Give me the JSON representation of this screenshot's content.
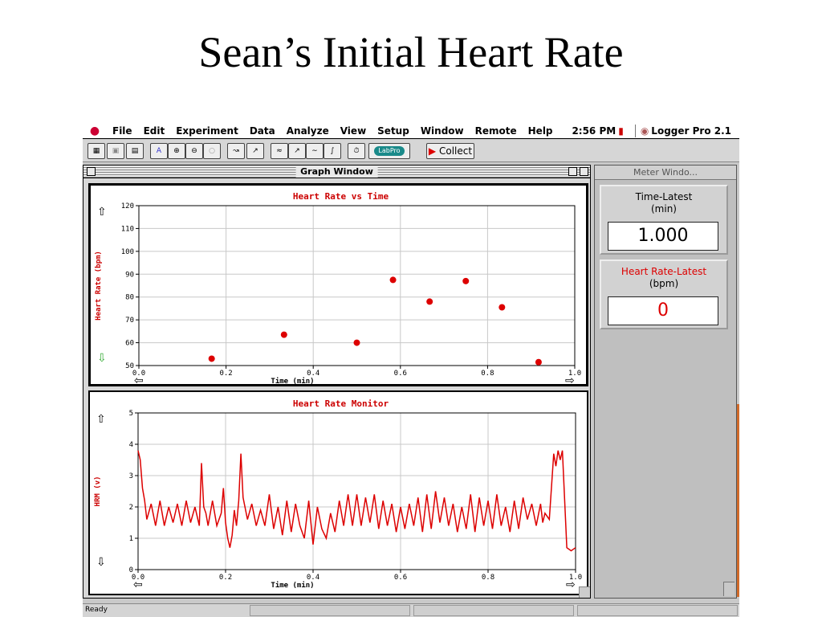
{
  "slide": {
    "title": "Sean’s Initial Heart Rate"
  },
  "menubar": {
    "items": [
      "File",
      "Edit",
      "Experiment",
      "Data",
      "Analyze",
      "View",
      "Setup",
      "Window",
      "Remote",
      "Help"
    ],
    "clock": "2:56 PM",
    "app_name": "Logger Pro 2.1"
  },
  "toolbar": {
    "buttons": [
      {
        "name": "open-button",
        "icon": "folder-icon"
      },
      {
        "name": "save-button",
        "icon": "disk-icon"
      },
      {
        "name": "print-button",
        "icon": "printer-icon"
      },
      {
        "name": "autoscale-button",
        "icon": "autoscale-icon"
      },
      {
        "name": "zoom-in-button",
        "icon": "zoom-in-icon"
      },
      {
        "name": "zoom-out-button",
        "icon": "zoom-out-icon"
      },
      {
        "name": "zoom-button",
        "icon": "zoom-icon"
      },
      {
        "name": "examine-button",
        "icon": "examine-icon"
      },
      {
        "name": "tangent-button",
        "icon": "tangent-icon"
      },
      {
        "name": "stats-button",
        "icon": "stats-icon"
      },
      {
        "name": "linear-fit-button",
        "icon": "linear-fit-icon"
      },
      {
        "name": "curve-fit-button",
        "icon": "curve-fit-icon"
      },
      {
        "name": "integral-button",
        "icon": "integral-icon"
      },
      {
        "name": "timer-button",
        "icon": "stopwatch-icon"
      }
    ],
    "labpro_label": "LabPro",
    "collect_label": "Collect"
  },
  "graph_window": {
    "title": "Graph Window"
  },
  "meter_window": {
    "title": "Meter Windo...",
    "meters": [
      {
        "label": "Time-Latest",
        "unit": "(min)",
        "value": "1.000",
        "color": "#000000"
      },
      {
        "label": "Heart Rate-Latest",
        "unit": "(bpm)",
        "value": "0",
        "color": "#dd0000"
      }
    ]
  },
  "status": {
    "text": "Ready"
  },
  "chart_data": [
    {
      "type": "scatter",
      "title": "Heart Rate vs Time",
      "xlabel": "Time (min)",
      "ylabel": "Heart Rate (bpm)",
      "xlim": [
        0.0,
        1.0
      ],
      "ylim": [
        50,
        120
      ],
      "xticks": [
        "0.0",
        "0.2",
        "0.4",
        "0.6",
        "0.8",
        "1.0"
      ],
      "yticks": [
        "50",
        "60",
        "70",
        "80",
        "90",
        "100",
        "110",
        "120"
      ],
      "grid": true,
      "color": "#dd0000",
      "x": [
        0.167,
        0.333,
        0.5,
        0.583,
        0.667,
        0.75,
        0.833,
        0.917
      ],
      "y": [
        53,
        63.5,
        60,
        87.5,
        78,
        87,
        75.5,
        51.5
      ]
    },
    {
      "type": "line",
      "title": "Heart Rate Monitor",
      "xlabel": "Time (min)",
      "ylabel": "HRM (v)",
      "xlim": [
        0.0,
        1.0
      ],
      "ylim": [
        0,
        5
      ],
      "xticks": [
        "0.0",
        "0.2",
        "0.4",
        "0.6",
        "0.8",
        "1.0"
      ],
      "yticks": [
        "0",
        "1",
        "2",
        "3",
        "4",
        "5"
      ],
      "grid": true,
      "color": "#dd0000",
      "x": [
        0.0,
        0.005,
        0.01,
        0.015,
        0.02,
        0.03,
        0.04,
        0.05,
        0.06,
        0.07,
        0.08,
        0.09,
        0.1,
        0.11,
        0.12,
        0.13,
        0.14,
        0.145,
        0.15,
        0.155,
        0.16,
        0.17,
        0.18,
        0.19,
        0.195,
        0.2,
        0.205,
        0.21,
        0.215,
        0.22,
        0.225,
        0.23,
        0.235,
        0.24,
        0.25,
        0.26,
        0.27,
        0.28,
        0.29,
        0.3,
        0.31,
        0.32,
        0.33,
        0.34,
        0.35,
        0.36,
        0.37,
        0.38,
        0.39,
        0.4,
        0.41,
        0.42,
        0.43,
        0.44,
        0.45,
        0.46,
        0.47,
        0.48,
        0.49,
        0.5,
        0.51,
        0.52,
        0.53,
        0.54,
        0.55,
        0.56,
        0.57,
        0.58,
        0.59,
        0.6,
        0.61,
        0.62,
        0.63,
        0.64,
        0.65,
        0.66,
        0.67,
        0.68,
        0.69,
        0.7,
        0.71,
        0.72,
        0.73,
        0.74,
        0.75,
        0.76,
        0.77,
        0.78,
        0.79,
        0.8,
        0.81,
        0.82,
        0.83,
        0.84,
        0.85,
        0.86,
        0.87,
        0.88,
        0.89,
        0.9,
        0.91,
        0.92,
        0.925,
        0.93,
        0.94,
        0.95,
        0.955,
        0.96,
        0.965,
        0.97,
        0.98,
        0.99,
        1.0
      ],
      "y": [
        3.8,
        3.5,
        2.6,
        2.2,
        1.6,
        2.1,
        1.4,
        2.2,
        1.4,
        2.0,
        1.5,
        2.1,
        1.4,
        2.2,
        1.5,
        2.0,
        1.4,
        3.4,
        2.0,
        1.8,
        1.4,
        2.2,
        1.4,
        1.8,
        2.6,
        1.5,
        1.0,
        0.7,
        1.1,
        1.9,
        1.4,
        2.2,
        3.7,
        2.3,
        1.6,
        2.1,
        1.4,
        1.9,
        1.4,
        2.4,
        1.3,
        2.0,
        1.1,
        2.2,
        1.2,
        2.1,
        1.4,
        1.0,
        2.2,
        0.8,
        2.0,
        1.3,
        1.0,
        1.8,
        1.2,
        2.2,
        1.4,
        2.4,
        1.4,
        2.4,
        1.4,
        2.3,
        1.5,
        2.4,
        1.3,
        2.2,
        1.4,
        2.1,
        1.2,
        2.0,
        1.3,
        2.1,
        1.4,
        2.3,
        1.2,
        2.4,
        1.3,
        2.5,
        1.5,
        2.3,
        1.4,
        2.1,
        1.2,
        2.0,
        1.3,
        2.4,
        1.2,
        2.3,
        1.4,
        2.2,
        1.3,
        2.4,
        1.4,
        2.0,
        1.2,
        2.2,
        1.3,
        2.3,
        1.6,
        2.1,
        1.4,
        2.1,
        1.5,
        1.8,
        1.6,
        3.7,
        3.3,
        3.8,
        3.5,
        3.8,
        0.7,
        0.6,
        0.7
      ]
    }
  ]
}
